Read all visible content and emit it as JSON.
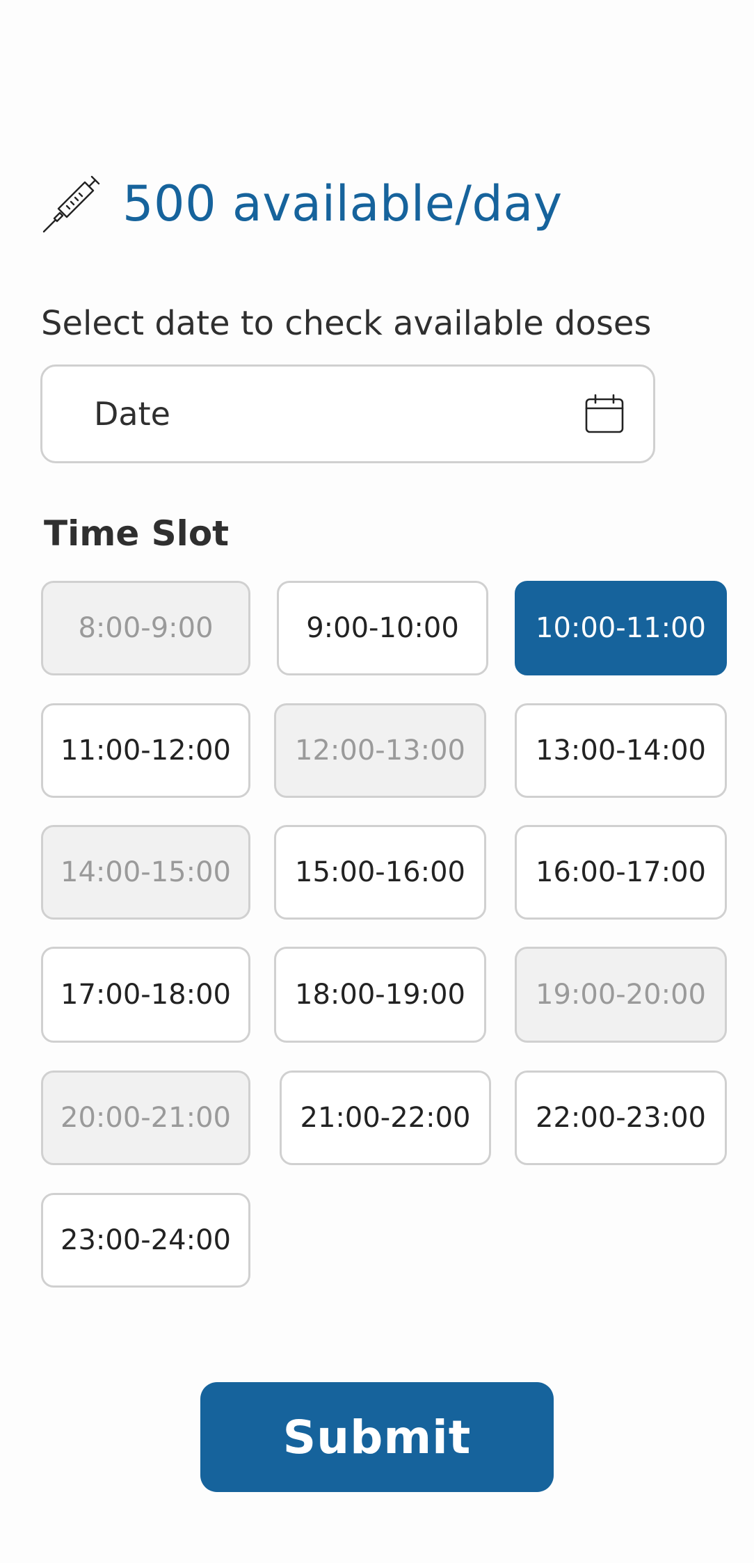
{
  "header": {
    "availability_text": "500 available/day",
    "icon": "syringe-icon"
  },
  "date_picker": {
    "label": "Select date to check available doses",
    "placeholder": "Date",
    "icon": "calendar-icon"
  },
  "time_slot": {
    "label": "Time Slot",
    "slots": [
      {
        "label": "8:00-9:00",
        "state": "disabled"
      },
      {
        "label": "9:00-10:00",
        "state": "available"
      },
      {
        "label": "10:00-11:00",
        "state": "selected"
      },
      {
        "label": "11:00-12:00",
        "state": "available"
      },
      {
        "label": "12:00-13:00",
        "state": "disabled"
      },
      {
        "label": "13:00-14:00",
        "state": "available"
      },
      {
        "label": "14:00-15:00",
        "state": "disabled"
      },
      {
        "label": "15:00-16:00",
        "state": "available"
      },
      {
        "label": "16:00-17:00",
        "state": "available"
      },
      {
        "label": "17:00-18:00",
        "state": "available"
      },
      {
        "label": "18:00-19:00",
        "state": "available"
      },
      {
        "label": "19:00-20:00",
        "state": "disabled"
      },
      {
        "label": "20:00-21:00",
        "state": "disabled"
      },
      {
        "label": "21:00-22:00",
        "state": "available"
      },
      {
        "label": "22:00-23:00",
        "state": "available"
      },
      {
        "label": "23:00-24:00",
        "state": "available"
      }
    ]
  },
  "submit": {
    "label": "Submit"
  },
  "colors": {
    "accent": "#16639c",
    "disabled_bg": "#f1f1f1",
    "disabled_text": "#9a9a9a",
    "border": "#d0d0d0"
  }
}
